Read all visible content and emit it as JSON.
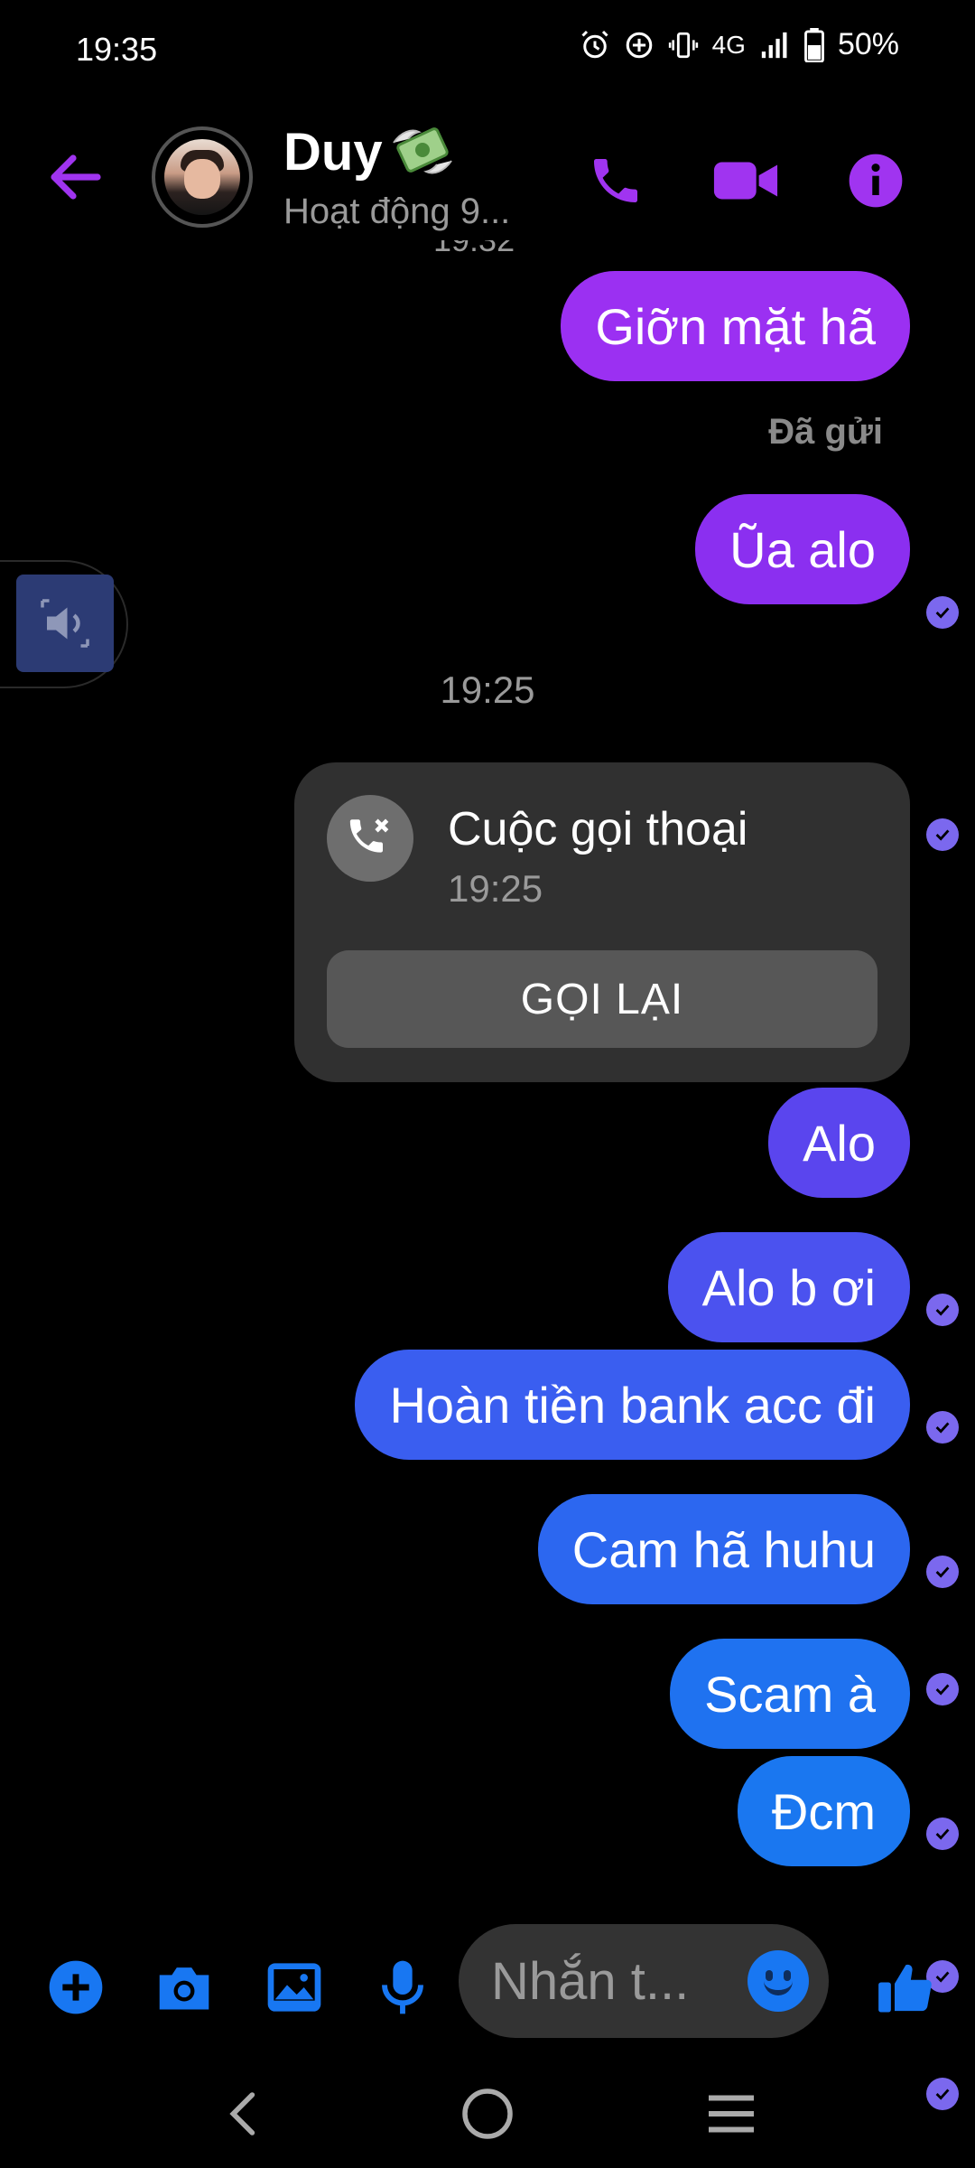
{
  "status_bar": {
    "time": "19:35",
    "network": "4G",
    "battery": "50%"
  },
  "header": {
    "contact_name": "Duy",
    "contact_status": "Hoạt động 9...",
    "accent_color": "#a034f0"
  },
  "chat": {
    "partial_timestamp": "19:32",
    "seen_label": "Đã gửi",
    "call_timestamp": "19:25",
    "call_card": {
      "title": "Cuộc gọi thoại",
      "time": "19:25",
      "callback_label": "GỌI LẠI"
    },
    "messages": [
      {
        "text": "Giỡn mặt hã",
        "color": "#9b30f2"
      },
      {
        "text": "Ũa alo",
        "color": "#8b2ff0"
      },
      {
        "text": "Alo",
        "color": "#5a45ee"
      },
      {
        "text": "Alo b ơi",
        "color": "#4b52ef"
      },
      {
        "text": "Hoàn tiền bank acc đi",
        "color": "#3a5ef0"
      },
      {
        "text": "Cam hã huhu",
        "color": "#2c67f0"
      },
      {
        "text": "Scam à",
        "color": "#1f72f0"
      },
      {
        "text": "Đcm",
        "color": "#1a77f0"
      }
    ]
  },
  "composer": {
    "placeholder": "Nhắn t...",
    "icon_color": "#1877f2"
  },
  "icons": {
    "header": [
      "back-arrow-icon",
      "phone-icon",
      "video-camera-icon",
      "info-icon"
    ],
    "composer": [
      "plus-icon",
      "camera-icon",
      "image-icon",
      "microphone-icon",
      "smile-icon",
      "thumbs-up-icon"
    ],
    "nav": [
      "nav-back-icon",
      "nav-home-icon",
      "nav-menu-icon"
    ]
  }
}
